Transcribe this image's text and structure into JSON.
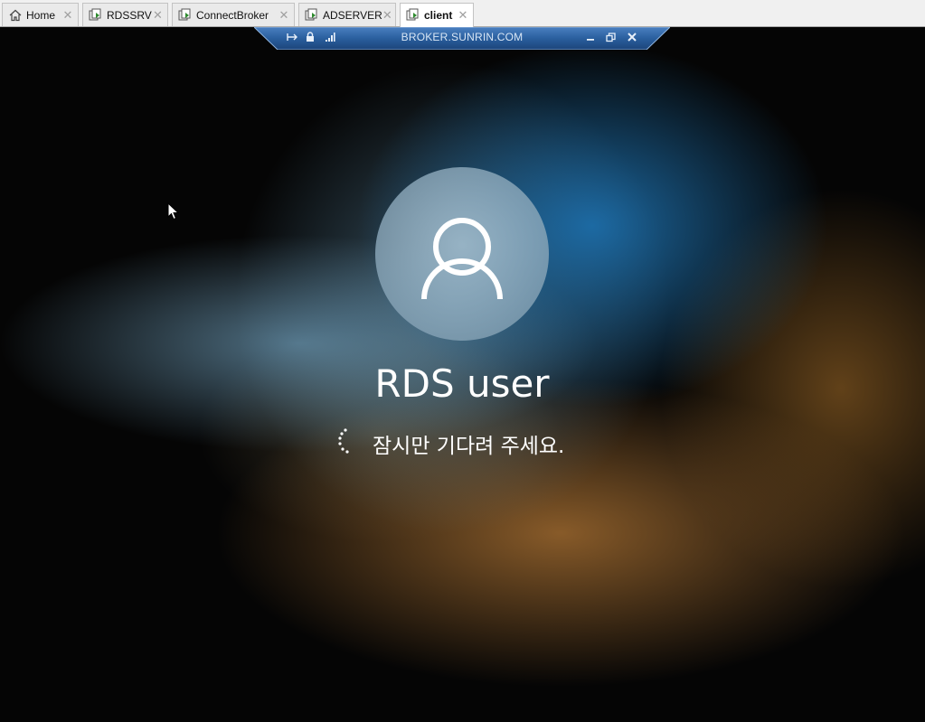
{
  "tabs": [
    {
      "label": "Home",
      "icon": "home-icon"
    },
    {
      "label": "RDSSRV",
      "icon": "vm-icon"
    },
    {
      "label": "ConnectBroker",
      "icon": "vm-icon"
    },
    {
      "label": "ADSERVER",
      "icon": "vm-icon"
    },
    {
      "label": "client",
      "icon": "vm-icon",
      "active": true
    }
  ],
  "connection_bar": {
    "title": "BROKER.SUNRIN.COM",
    "icons": [
      "pin-icon",
      "lock-icon",
      "signal-icon",
      "minimize-icon",
      "restore-icon",
      "close-icon"
    ]
  },
  "login": {
    "user_name": "RDS user",
    "status": "잠시만 기다려 주세요."
  },
  "colors": {
    "tab_bar": "#f0f0f0",
    "conn_bar": "#2a5f9e",
    "text": "#ffffff"
  }
}
